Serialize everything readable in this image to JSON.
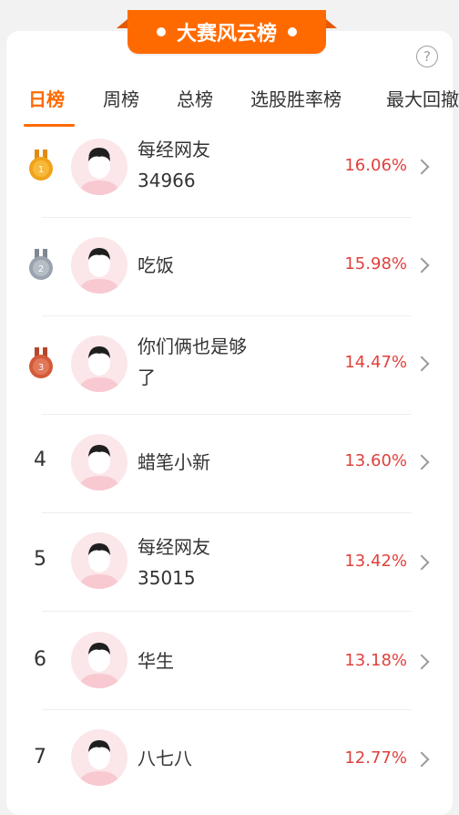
{
  "header": {
    "title": "大赛风云榜",
    "help_glyph": "?"
  },
  "tabs": [
    {
      "label": "日榜",
      "active": true
    },
    {
      "label": "周榜",
      "active": false
    },
    {
      "label": "总榜",
      "active": false
    },
    {
      "label": "选股胜率榜",
      "active": false
    },
    {
      "label": "最大回撤",
      "active": false
    }
  ],
  "colors": {
    "accent": "#ff6a00",
    "gain": "#e0413d",
    "gold": "#f1a21a",
    "silver": "#9aa3ad",
    "bronze": "#d35a3a"
  },
  "leaderboard": [
    {
      "rank": "1",
      "medal": "gold-medal-icon",
      "name_line1": "每经网友",
      "name_line2": "34966",
      "pct": "16.06%"
    },
    {
      "rank": "2",
      "medal": "silver-medal-icon",
      "name_line1": "吃饭",
      "name_line2": "",
      "pct": "15.98%"
    },
    {
      "rank": "3",
      "medal": "bronze-medal-icon",
      "name_line1": "你们俩也是够",
      "name_line2": "了",
      "pct": "14.47%"
    },
    {
      "rank": "4",
      "medal": "",
      "name_line1": "蜡笔小新",
      "name_line2": "",
      "pct": "13.60%"
    },
    {
      "rank": "5",
      "medal": "",
      "name_line1": "每经网友",
      "name_line2": "35015",
      "pct": "13.42%"
    },
    {
      "rank": "6",
      "medal": "",
      "name_line1": "华生",
      "name_line2": "",
      "pct": "13.18%"
    },
    {
      "rank": "7",
      "medal": "",
      "name_line1": "八七八",
      "name_line2": "",
      "pct": "12.77%"
    }
  ]
}
